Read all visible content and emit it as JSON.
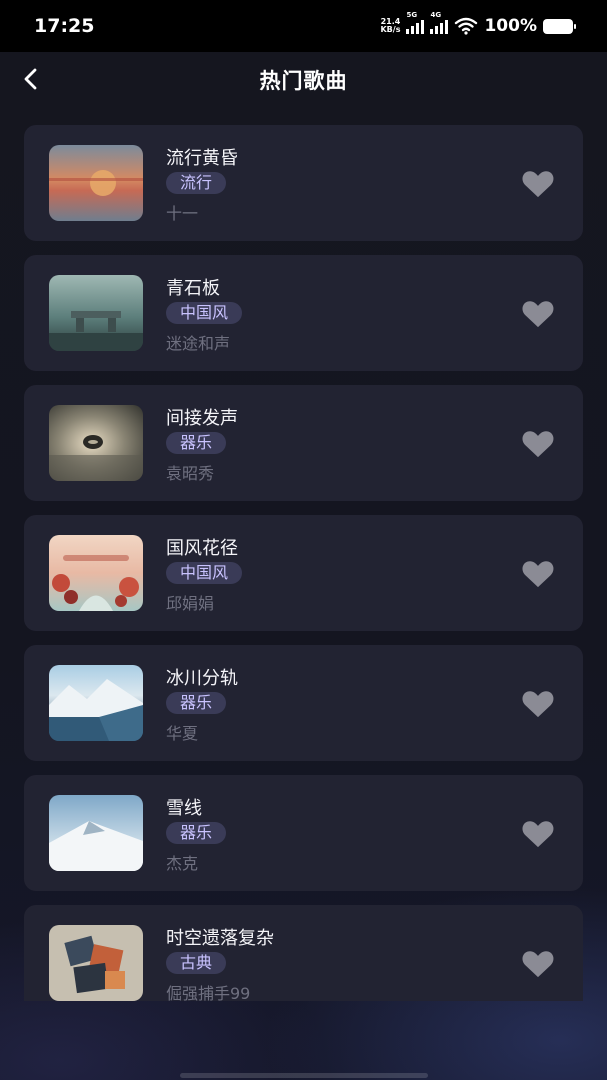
{
  "status_bar": {
    "time": "17:25",
    "net_speed_value": "21.4",
    "net_speed_unit": "KB/s",
    "signal_1": "5G",
    "signal_2": "4G",
    "battery": "100%"
  },
  "header": {
    "title": "热门歌曲",
    "back_icon": "chevron-left-icon"
  },
  "songs": [
    {
      "title": "流行黄昏",
      "tag": "流行",
      "artist": "十一",
      "cover": "sunset-cover",
      "liked": false
    },
    {
      "title": "青石板",
      "tag": "中国风",
      "artist": "迷途和声",
      "cover": "stone-bench-cover",
      "liked": false
    },
    {
      "title": "间接发声",
      "tag": "器乐",
      "artist": "袁昭秀",
      "cover": "misty-orb-cover",
      "liked": false
    },
    {
      "title": "国风花径",
      "tag": "中国风",
      "artist": "邱娟娟",
      "cover": "flower-path-cover",
      "liked": false
    },
    {
      "title": "冰川分轨",
      "tag": "器乐",
      "artist": "华夏",
      "cover": "glacier-cover",
      "liked": false
    },
    {
      "title": "雪线",
      "tag": "器乐",
      "artist": "杰克",
      "cover": "snow-mountain-cover",
      "liked": false
    },
    {
      "title": "时空遗落复杂",
      "tag": "古典",
      "artist": "倔强捕手99",
      "cover": "abstract-cubes-cover",
      "liked": false
    }
  ],
  "colors": {
    "background": "#14151f",
    "card": "#222332",
    "tag_bg": "#3a3b57",
    "tag_text": "#c9c3ff",
    "artist_text": "#6f7080",
    "heart": "#8b8b95"
  }
}
